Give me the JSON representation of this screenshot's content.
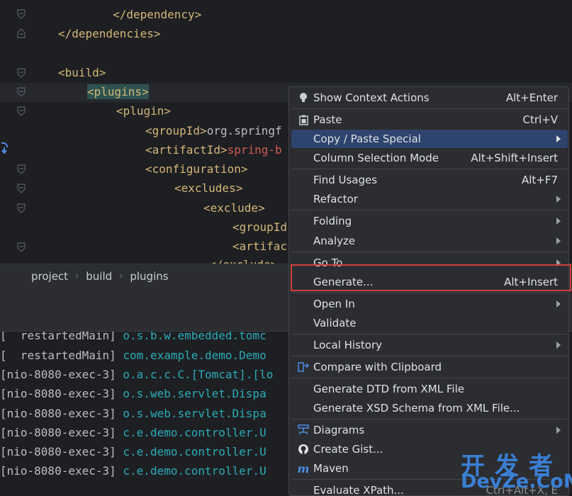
{
  "editor": {
    "lines": [
      {
        "indent": "        ",
        "tag_open": "</dependency>"
      },
      {
        "indent": "    ",
        "tag_open": "</dependencies>"
      },
      {
        "indent": "    ",
        "tag_open": "<build>"
      },
      {
        "indent": "        ",
        "tag_open": "<plugins>"
      },
      {
        "indent": "            ",
        "tag_open": "<plugin>"
      },
      {
        "indent": "                ",
        "tag_open": "<groupId>",
        "value": "org.springf"
      },
      {
        "indent": "                ",
        "tag_open": "<artifactId>",
        "value": "spring-b"
      },
      {
        "indent": "                ",
        "tag_open": "<configuration>"
      },
      {
        "indent": "                    ",
        "tag_open": "<excludes>"
      },
      {
        "indent": "                        ",
        "tag_open": "<exclude>"
      },
      {
        "indent": "                            ",
        "tag_open": "<groupId"
      },
      {
        "indent": "                            ",
        "tag_open": "<artifac"
      }
    ],
    "partial_line_top": "</exclude>"
  },
  "breadcrumb": {
    "items": [
      "project",
      "build",
      "plugins"
    ]
  },
  "console": {
    "lines": [
      {
        "thread": "[  restartedMain]",
        "cls": "o.s.b.w.embedded.tomc"
      },
      {
        "thread": "[  restartedMain]",
        "cls": "com.example.demo.Demo"
      },
      {
        "thread": "[nio-8080-exec-3]",
        "cls": "o.a.c.c.C.[Tomcat].[lo"
      },
      {
        "thread": "[nio-8080-exec-3]",
        "cls": "o.s.web.servlet.Dispa"
      },
      {
        "thread": "[nio-8080-exec-3]",
        "cls": "o.s.web.servlet.Dispa"
      },
      {
        "thread": "[nio-8080-exec-3]",
        "cls": "c.e.demo.controller.U"
      },
      {
        "thread": "[nio-8080-exec-3]",
        "cls": "c.e.demo.controller.U"
      },
      {
        "thread": "[nio-8080-exec-3]",
        "cls": "c.e.demo.controller.U"
      }
    ]
  },
  "menu": {
    "items": [
      {
        "label": "Show Context Actions",
        "shortcut": "Alt+Enter",
        "icon": "lightbulb-icon"
      },
      {
        "label": "Paste",
        "shortcut": "Ctrl+V",
        "icon": "clipboard-icon"
      },
      {
        "label": "Copy / Paste Special",
        "submenu": true,
        "selected": true
      },
      {
        "label": "Column Selection Mode",
        "shortcut": "Alt+Shift+Insert"
      },
      {
        "label": "Find Usages",
        "shortcut": "Alt+F7"
      },
      {
        "label": "Refactor",
        "submenu": true
      },
      {
        "label": "Folding",
        "submenu": true
      },
      {
        "label": "Analyze",
        "submenu": true
      },
      {
        "label": "Go To",
        "submenu": true
      },
      {
        "label": "Generate...",
        "shortcut": "Alt+Insert"
      },
      {
        "label": "Open In",
        "submenu": true
      },
      {
        "label": "Validate"
      },
      {
        "label": "Local History",
        "submenu": true
      },
      {
        "label": "Compare with Clipboard",
        "icon": "compare-icon"
      },
      {
        "label": "Generate DTD from XML File"
      },
      {
        "label": "Generate XSD Schema from XML File..."
      },
      {
        "label": "Diagrams",
        "submenu": true,
        "icon": "diagram-icon"
      },
      {
        "label": "Create Gist...",
        "icon": "github-icon"
      },
      {
        "label": "Maven",
        "icon": "maven-icon"
      },
      {
        "label": "Evaluate XPath...",
        "shortcut": "Ctrl+Alt+X, E"
      }
    ]
  },
  "watermark": {
    "cn": "开发者",
    "en": "DevZe.CoM"
  },
  "colors": {
    "menu_bg": "#2b2d30",
    "selected_bg": "#2e436e",
    "highlight_box": "#d0413d",
    "tag": "#d5b778",
    "console_class": "#2aacb8"
  }
}
